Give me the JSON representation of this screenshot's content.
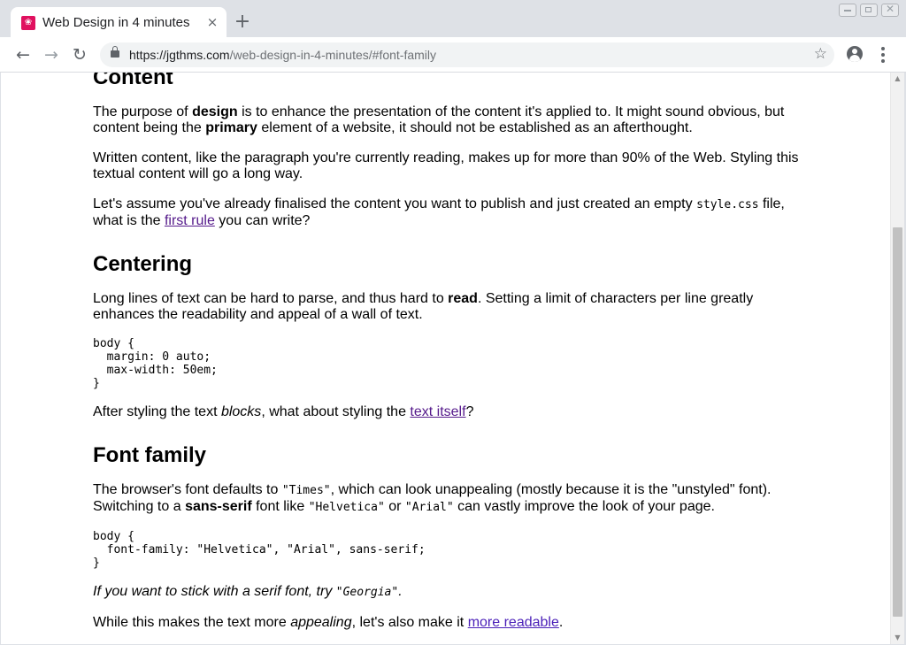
{
  "browser": {
    "tab_title": "Web Design in 4 minutes",
    "tab_favicon_glyph": "❀",
    "url_host": "https://jgthms.com",
    "url_path": "/web-design-in-4-minutes/#font-family",
    "back_icon": "arrow-left-icon",
    "forward_icon": "arrow-right-icon",
    "reload_icon": "reload-icon",
    "star_icon": "star-outline-icon",
    "close_glyph": "×",
    "new_tab_glyph": "+"
  },
  "sections": {
    "content": {
      "heading": "Content",
      "p1": {
        "a": "The purpose of ",
        "b1": "design",
        "c": " is to enhance the presentation of the content it's applied to. It might sound obvious, but content being the ",
        "b2": "primary",
        "d": " element of a website, it should not be established as an afterthought."
      },
      "p2": "Written content, like the paragraph you're currently reading, makes up for more than 90% of the Web. Styling this textual content will go a long way.",
      "p3": {
        "a": "Let's assume you've already finalised the content you want to publish and just created an empty ",
        "code": "style.css",
        "b": " file, what is the ",
        "link": "first rule",
        "c": " you can write?"
      }
    },
    "centering": {
      "heading": "Centering",
      "p1": {
        "a": "Long lines of text can be hard to parse, and thus hard to ",
        "b": "read",
        "c": ". Setting a limit of characters per line greatly enhances the readability and appeal of a wall of text."
      },
      "code": "body {\n  margin: 0 auto;\n  max-width: 50em;\n}",
      "p2": {
        "a": "After styling the text ",
        "em": "blocks",
        "b": ", what about styling the ",
        "link": "text itself",
        "c": "?"
      }
    },
    "font_family": {
      "heading": "Font family",
      "p1": {
        "a": "The browser's font defaults to ",
        "code1": "\"Times\"",
        "b": ", which can look unappealing (mostly because it is the \"unstyled\" font). Switching to a ",
        "strong": "sans-serif",
        "c": " font like ",
        "code2": "\"Helvetica\"",
        "d": " or ",
        "code3": "\"Arial\"",
        "e": " can vastly improve the look of your page."
      },
      "code": "body {\n  font-family: \"Helvetica\", \"Arial\", sans-serif;\n}",
      "p2": {
        "em": "If you want to stick with a serif font, try ",
        "code": "\"Georgia\"",
        "end": "."
      },
      "p3": {
        "a": "While this makes the text more ",
        "em": "appealing",
        "b": ", let's also make it ",
        "link": "more readable",
        "c": "."
      }
    }
  },
  "colors": {
    "link_visited": "#551a8b",
    "link_unvisited": "#0000ee",
    "chrome_bg": "#dee1e6"
  }
}
